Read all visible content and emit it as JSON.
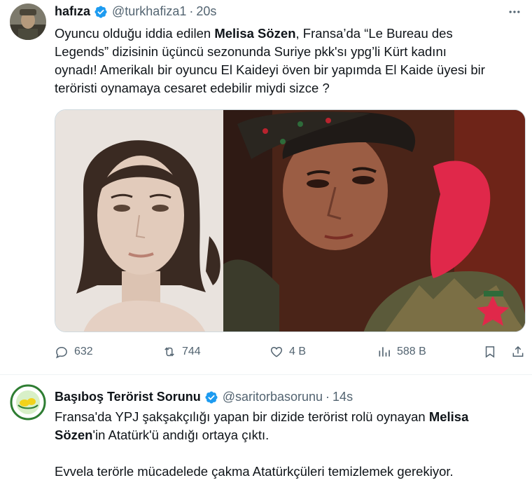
{
  "tweets": [
    {
      "name": "hafıza",
      "handle": "@turkhafiza1",
      "time": "20s",
      "text_lines": [
        [
          {
            "t": "Oyuncu olduğu iddia edilen "
          },
          {
            "t": "Melisa Sözen",
            "b": true
          },
          {
            "t": ", Fransa’da “Le Bureau des"
          }
        ],
        [
          {
            "t": "Legends” dizisinin üçüncü sezonunda Suriye pkk'sı ypg’li Kürt kadını"
          }
        ],
        [
          {
            "t": "oynadı! Amerikalı bir oyuncu El Kaideyi öven bir yapımda El Kaide üyesi bir"
          }
        ],
        [
          {
            "t": "teröristi oynamaya cesaret edebilir miydi sizce ?"
          }
        ]
      ],
      "actions": {
        "replies": "632",
        "reposts": "744",
        "likes": "4 B",
        "views": "588 B"
      }
    },
    {
      "name": "Başıboş Terörist Sorunu",
      "handle": "@saritorbasorunu",
      "time": "14s",
      "text_lines": [
        [
          {
            "t": "Fransa'da YPJ şakşakçılığı yapan bir dizide terörist rolü oynayan "
          },
          {
            "t": "Melisa",
            "b": true
          }
        ],
        [
          {
            "t": "Sözen",
            "b": true
          },
          {
            "t": "'in Atatürk'ü andığı ortaya çıktı."
          }
        ],
        [],
        [
          {
            "t": "Evvela terörle mücadelede çakma Atatürkçüleri temizlemek gerekiyor."
          }
        ]
      ]
    }
  ],
  "colors": {
    "verified": "#1d9bf0",
    "muted": "#536471",
    "text": "#0f1419"
  },
  "icons": [
    "reply-icon",
    "repost-icon",
    "like-icon",
    "views-icon",
    "bookmark-icon",
    "share-icon",
    "more-icon",
    "verified-badge-icon"
  ]
}
